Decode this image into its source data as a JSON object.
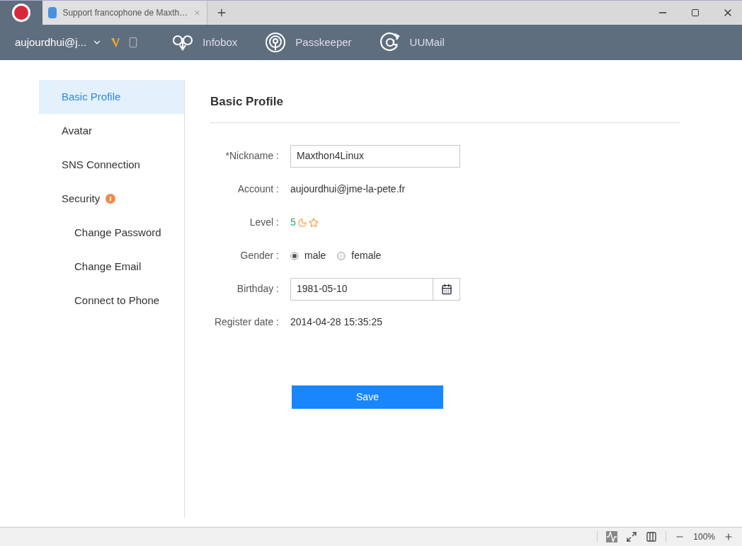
{
  "tabs": [
    {
      "title": "Support francophone de Maxth…",
      "selected": true
    }
  ],
  "toolbar": {
    "account": "aujourdhui@j...",
    "apps": [
      {
        "kind": "infobox",
        "label": "Infobox"
      },
      {
        "kind": "passkeeper",
        "label": "Passkeeper"
      },
      {
        "kind": "uumail",
        "label": "UUMail"
      }
    ]
  },
  "sidebar": {
    "items": [
      {
        "label": "Basic Profile",
        "selected": true,
        "alert": false
      },
      {
        "label": "Avatar",
        "selected": false,
        "alert": false
      },
      {
        "label": "SNS Connection",
        "selected": false,
        "alert": false
      },
      {
        "label": "Security",
        "selected": false,
        "alert": true,
        "children": [
          {
            "label": "Change Password",
            "selected": false
          },
          {
            "label": "Change Email",
            "selected": false
          },
          {
            "label": "Connect to Phone",
            "selected": false
          }
        ]
      }
    ]
  },
  "form": {
    "title": "Basic Profile",
    "fields": [
      {
        "kind": "input",
        "label": "*Nickname :",
        "value": "Maxthon4Linux"
      },
      {
        "kind": "text",
        "label": "Account :",
        "value": "aujourdhui@jme-la-pete.fr"
      },
      {
        "kind": "level",
        "label": "Level :",
        "value": "5"
      },
      {
        "kind": "radio",
        "label": "Gender :",
        "options": [
          {
            "label": "male",
            "selected": true
          },
          {
            "label": "female",
            "selected": false
          }
        ]
      },
      {
        "kind": "date",
        "label": "Birthday :",
        "value": "1981-05-10"
      },
      {
        "kind": "text",
        "label": "Register date :",
        "value": "2014-04-28 15:35:25"
      }
    ],
    "save": "Save"
  },
  "status_bar": {
    "zoom": "100%"
  }
}
